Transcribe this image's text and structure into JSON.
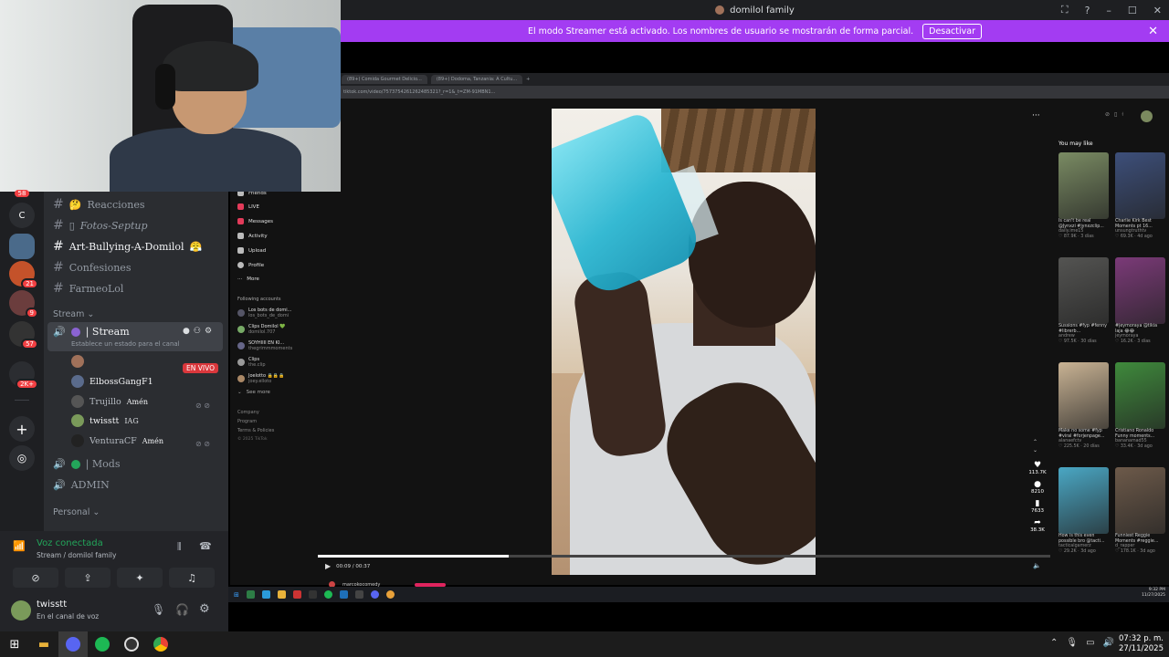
{
  "window": {
    "title": "domilol family",
    "controls": [
      "⛶",
      "?",
      "–",
      "☐",
      "✕"
    ]
  },
  "banner": {
    "text": "El modo Streamer está activado. Los nombres de usuario se mostrarán de forma parcial.",
    "button": "Desactivar",
    "close": "✕"
  },
  "servers": [
    {
      "label": "C",
      "badge": ""
    },
    {
      "label": "",
      "badge": ""
    },
    {
      "label": "",
      "badge": "21"
    },
    {
      "label": "",
      "badge": "9"
    },
    {
      "label": "",
      "badge": "57"
    },
    {
      "label": "",
      "badge": "2K+"
    }
  ],
  "server_top_badge": "58",
  "channels": [
    {
      "icon": "#",
      "emoji": "🤔",
      "name": "Reacciones",
      "bold": false
    },
    {
      "icon": "#",
      "emoji": "▯",
      "name": "Fotos-Septup",
      "bold": false
    },
    {
      "icon": "#",
      "emoji": "",
      "name": "Art-Bullying-A-Domilol",
      "bold": true,
      "suffix": "😤"
    },
    {
      "icon": "#",
      "emoji": "",
      "name": "Confesiones",
      "bold": false
    },
    {
      "icon": "#",
      "emoji": "",
      "name": "FarmeoLol",
      "bold": false
    }
  ],
  "category_stream": "Stream",
  "voice_channel": {
    "name": "| Stream",
    "status": "Establece un estado para el canal",
    "live_label": "EN VIVO"
  },
  "voice_users": [
    {
      "name": "ElbossGangF1",
      "tag": ""
    },
    {
      "name": "Trujillo",
      "tag": "Amén"
    },
    {
      "name": "twisstt",
      "tag": "IAG"
    },
    {
      "name": "VenturaCF",
      "tag": "Amén"
    }
  ],
  "other_channels": [
    {
      "name": "| Mods"
    },
    {
      "name": "ADMIN"
    }
  ],
  "category_personal": "Personal",
  "voice_panel": {
    "status": "Voz conectada",
    "sub": "Stream / domilol family"
  },
  "user": {
    "name": "twisstt",
    "status": "En el canal de voz"
  },
  "browser": {
    "tabs": [
      "(89+) Comida Gourmet Delicio...",
      "(89+) Dodoma, Tanzania: A Cultu..."
    ],
    "address": "tiktok.com/video/7573754261262485321?_r=1&_t=ZM-91MBN1..."
  },
  "tiktok_nav": [
    "Friends",
    "LIVE",
    "Messages",
    "Activity",
    "Upload",
    "Profile",
    "More"
  ],
  "following_title": "Following accounts",
  "following": [
    {
      "name": "Los bots de domi...",
      "handle": "los_bots_de_domi"
    },
    {
      "name": "Clips Domilol 💚",
      "handle": "domilol.707"
    },
    {
      "name": "SOYHIIII EN KI...",
      "handle": "thegrimmmoments"
    },
    {
      "name": "Clips",
      "handle": "the.clip"
    },
    {
      "name": "Joelotto 🔒🔒🔒",
      "handle": "joey.elloto"
    }
  ],
  "see_more": "See more",
  "footer_links": [
    "Company",
    "Program",
    "Terms & Policies",
    "© 2025 TikTok"
  ],
  "video": {
    "time": "00:09 / 00:37",
    "progress": 0.26,
    "menu": "···"
  },
  "actions": [
    {
      "icon": "♥",
      "count": "113.7K"
    },
    {
      "icon": "●",
      "count": "8210"
    },
    {
      "icon": "▮",
      "count": "7633"
    },
    {
      "icon": "➦",
      "count": "38.3K"
    }
  ],
  "you_may_like": {
    "title": "You may like",
    "items": [
      {
        "caption": "Is can't be real @Jynxzi #jynxzclip...",
        "author": "daily.ime15",
        "likes": "♡ 87.9K",
        "age": "3 días",
        "color": "#7a8b63"
      },
      {
        "caption": "Charlie Kirk Best Moments pt 16...",
        "author": "unsungtruthtv",
        "likes": "♡ 69.3K",
        "age": "4d ago",
        "color": "#3d4f7a"
      },
      {
        "caption": "Sussions #fyp #fenny #librerb...",
        "author": "andrew",
        "likes": "♡ 97.5K",
        "age": "30 días",
        "color": "#545452"
      },
      {
        "caption": "#jeymoraya @tikia laja 😂😂",
        "author": "jeymoraya",
        "likes": "♡ 16.2K",
        "age": "3 días",
        "color": "#7b3a78"
      },
      {
        "caption": "Make no some #fyp #viral #forjenpage...",
        "author": "alanaefctv",
        "likes": "♡ 225.5K",
        "age": "20 días",
        "color": "#c9b394"
      },
      {
        "caption": "Cristiano Ronaldo Funny moments...",
        "author": "bananamad55",
        "likes": "♡ 33.4K",
        "age": "3d ago",
        "color": "#3f8a3c"
      },
      {
        "caption": "How is this even possible bro @tacti...",
        "author": "tacticalgamerz",
        "likes": "♡ 29.2K",
        "age": "3d ago",
        "color": "#4aa7c4"
      },
      {
        "caption": "Funniest Reggie Moments #reggie...",
        "author": "d_rapper",
        "likes": "♡ 178.1K",
        "age": "3d ago",
        "color": "#6d5a4a"
      }
    ]
  },
  "inner_clock": {
    "time": "9:32 PM",
    "date": "11/27/2025"
  },
  "clock": {
    "time": "07:32 p. m.",
    "date": "27/11/2025"
  },
  "bottom_handle": "marcokocomedy"
}
